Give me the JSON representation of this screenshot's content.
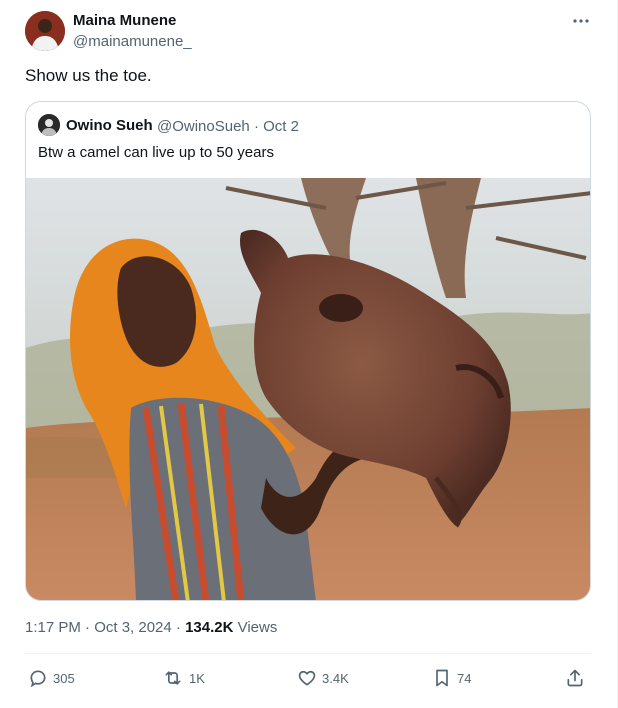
{
  "author": {
    "name": "Maina Munene",
    "handle": "@mainamunene_"
  },
  "tweet": {
    "text": "Show us the toe."
  },
  "quoted": {
    "name": "Owino Sueh",
    "handle_date": "@OwinoSueh · Oct 2",
    "text": "Btw a camel can live up to 50 years",
    "media_description_icon": "photo-woman-holding-camel-head"
  },
  "meta": {
    "timestamp": "1:17 PM · Oct 3, 2024 · ",
    "views_count": "134.2K",
    "views_label": " Views"
  },
  "actions": {
    "replies": "305",
    "reposts": "1K",
    "likes": "3.4K",
    "bookmarks": "74"
  },
  "colors": {
    "text": "#0f1419",
    "secondary": "#536471",
    "border": "#cfd9de"
  }
}
